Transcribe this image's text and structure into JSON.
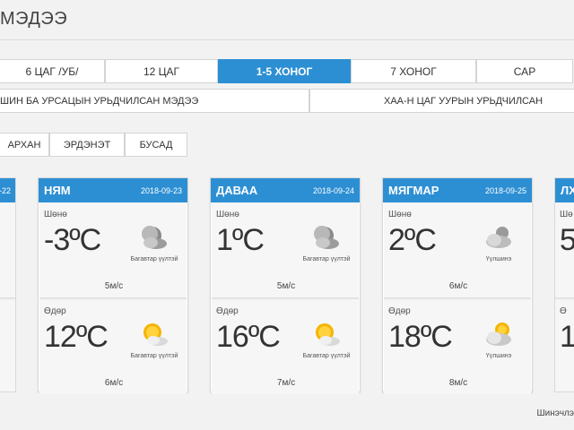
{
  "page": {
    "title": "МЭДЭЭ"
  },
  "tabs": [
    {
      "label": "6 ЦАГ /УБ/",
      "active": false
    },
    {
      "label": "12 ЦАГ",
      "active": false
    },
    {
      "label": "1-5 ХОНОГ",
      "active": true
    },
    {
      "label": "7 ХОНОГ",
      "active": false
    },
    {
      "label": "САР",
      "active": false
    }
  ],
  "subtabs": [
    {
      "label": "ШИН БА УРСАЦЫН УРЬДЧИЛСАН МЭДЭЭ"
    },
    {
      "label": "ХАА-Н ЦАГ УУРЫН УРЬДЧИЛСАН"
    }
  ],
  "cities": [
    {
      "label": "АРХАН"
    },
    {
      "label": "ЭРДЭНЭТ"
    },
    {
      "label": "БУСАД"
    }
  ],
  "left_partial": {
    "date": "-22"
  },
  "cards": [
    {
      "day": "НЯМ",
      "date": "2018-09-23",
      "night": {
        "label": "Шөнө",
        "temp": "-3ºC",
        "icon": "cloud-moon-icon",
        "condition": "Багавтар үүлтэй",
        "wind": "5м/с"
      },
      "day_part": {
        "label": "Өдөр",
        "temp": "12ºC",
        "icon": "sun-cloud-icon",
        "condition": "Багавтар үүлтэй",
        "wind": "6м/с"
      }
    },
    {
      "day": "ДАВАА",
      "date": "2018-09-24",
      "night": {
        "label": "Шөнө",
        "temp": "1ºC",
        "icon": "cloud-moon-icon",
        "condition": "Багавтар үүлтэй",
        "wind": "5м/с"
      },
      "day_part": {
        "label": "Өдөр",
        "temp": "16ºC",
        "icon": "sun-cloud-icon",
        "condition": "Багавтар үүлтэй",
        "wind": "7м/с"
      }
    },
    {
      "day": "МЯГМАР",
      "date": "2018-09-25",
      "night": {
        "label": "Шөнө",
        "temp": "2ºC",
        "icon": "cloudy-moon-icon",
        "condition": "Үүлшинэ",
        "wind": "6м/с"
      },
      "day_part": {
        "label": "Өдөр",
        "temp": "18ºC",
        "icon": "cloudy-sun-icon",
        "condition": "Үүлшинэ",
        "wind": "8м/с"
      }
    }
  ],
  "right_partial": {
    "day": "ЛХ",
    "night_label": "Шө",
    "night_temp": "5",
    "day_label": "Ө",
    "day_temp": "1"
  },
  "footer": {
    "note": "Шинэчлэ"
  },
  "colors": {
    "accent": "#2d8fd3",
    "background": "#f2f2f2"
  }
}
